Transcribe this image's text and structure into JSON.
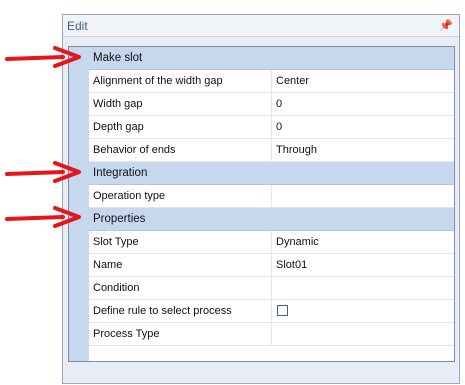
{
  "panel": {
    "title": "Edit",
    "pin_icon": "pin-icon"
  },
  "categories": [
    {
      "label": "Make slot",
      "properties": [
        {
          "name": "Alignment of the width gap",
          "value": "Center"
        },
        {
          "name": "Width gap",
          "value": "0"
        },
        {
          "name": "Depth gap",
          "value": "0"
        },
        {
          "name": "Behavior of ends",
          "value": "Through"
        }
      ]
    },
    {
      "label": "Integration",
      "properties": [
        {
          "name": "Operation type",
          "value": ""
        }
      ]
    },
    {
      "label": "Properties",
      "properties": [
        {
          "name": "Slot Type",
          "value": "Dynamic"
        },
        {
          "name": "Name",
          "value": "Slot01"
        },
        {
          "name": "Condition",
          "value": ""
        },
        {
          "name": "Define rule to select process",
          "value": "",
          "checkbox": false
        },
        {
          "name": "Process Type",
          "value": ""
        }
      ]
    }
  ],
  "annotations": {
    "arrow_color": "#e8141a"
  }
}
